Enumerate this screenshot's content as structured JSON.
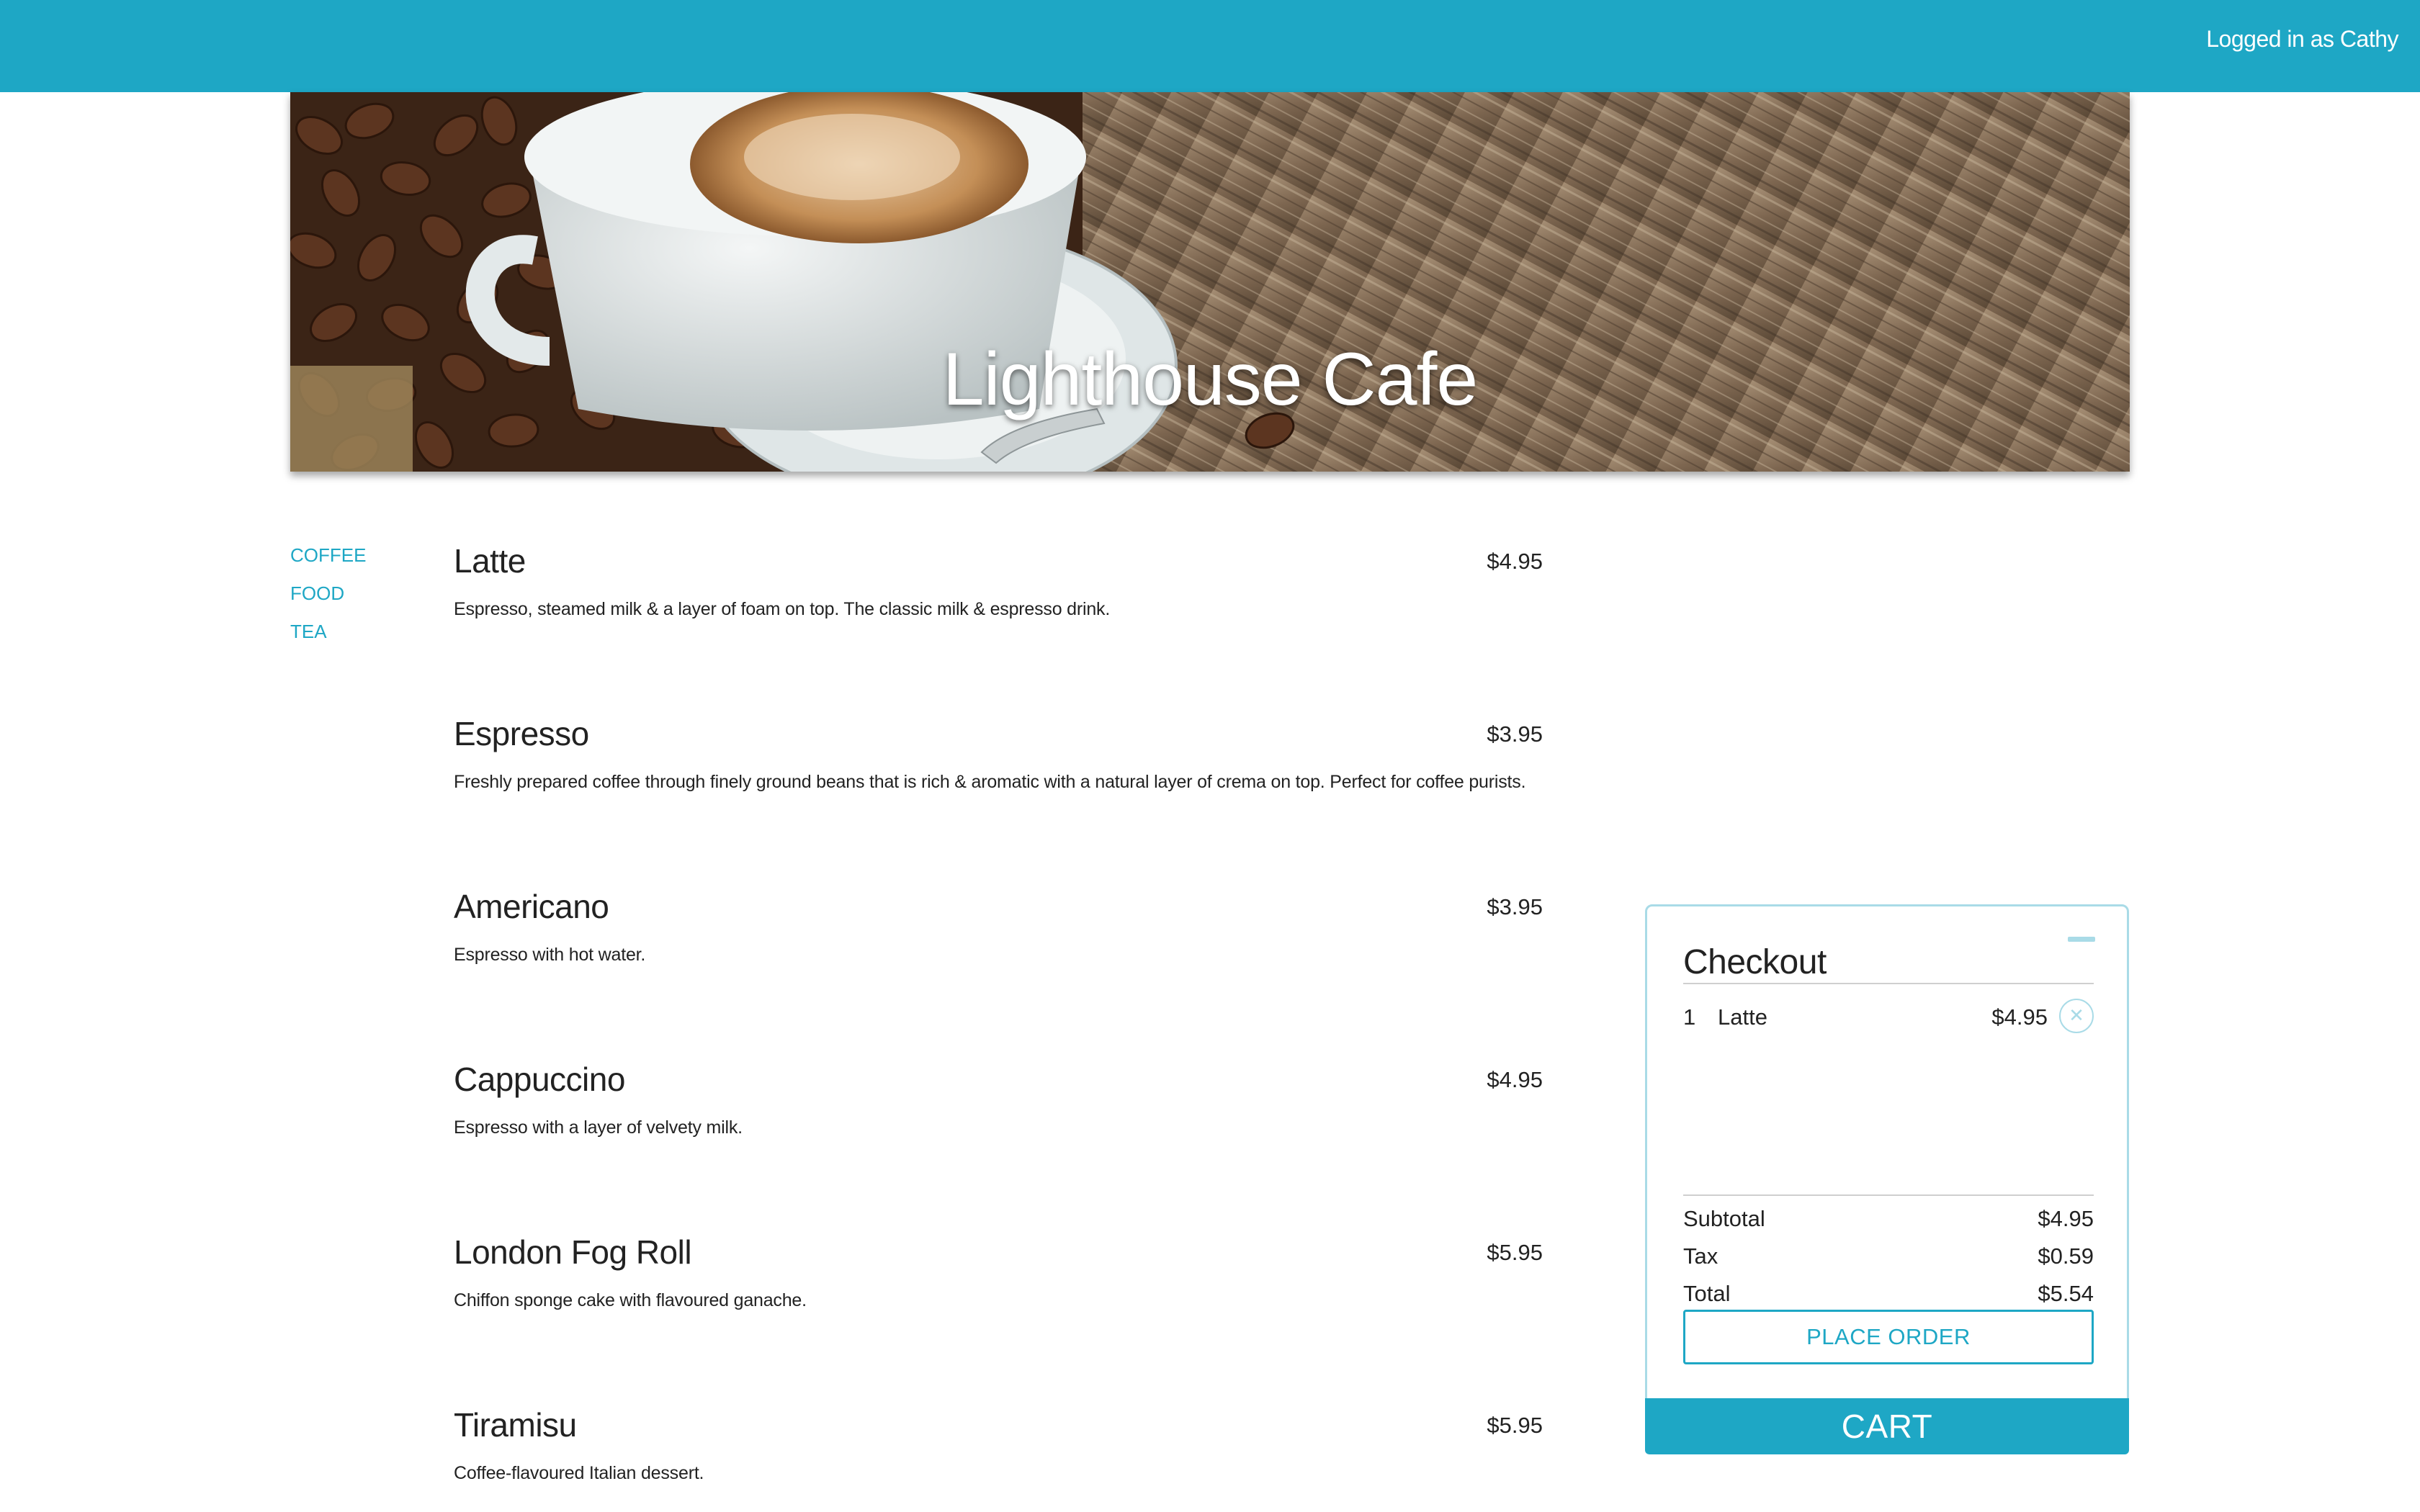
{
  "header": {
    "login_status": "Logged in as Cathy"
  },
  "hero": {
    "title": "Lighthouse Cafe"
  },
  "categories": [
    "COFFEE",
    "FOOD",
    "TEA"
  ],
  "menu_items": [
    {
      "name": "Latte",
      "price": "$4.95",
      "description": "Espresso, steamed milk & a layer of foam on top. The classic milk & espresso drink."
    },
    {
      "name": "Espresso",
      "price": "$3.95",
      "description": "Freshly prepared coffee through finely ground beans that is rich & aromatic with a natural layer of crema on top. Perfect for coffee purists."
    },
    {
      "name": "Americano",
      "price": "$3.95",
      "description": "Espresso with hot water."
    },
    {
      "name": "Cappuccino",
      "price": "$4.95",
      "description": "Espresso with a layer of velvety milk."
    },
    {
      "name": "London Fog Roll",
      "price": "$5.95",
      "description": "Chiffon sponge cake with flavoured ganache."
    },
    {
      "name": "Tiramisu",
      "price": "$5.95",
      "description": "Coffee-flavoured Italian dessert."
    }
  ],
  "checkout": {
    "title": "Checkout",
    "items": [
      {
        "qty": "1",
        "name": "Latte",
        "price": "$4.95",
        "remove_icon": "close-icon"
      }
    ],
    "subtotal_label": "Subtotal",
    "subtotal": "$4.95",
    "tax_label": "Tax",
    "tax": "$0.59",
    "total_label": "Total",
    "total": "$5.54",
    "place_order_label": "PLACE ORDER",
    "cart_label": "CART"
  },
  "colors": {
    "accent": "#1ea7c5",
    "light_accent": "#a9dbe7"
  }
}
